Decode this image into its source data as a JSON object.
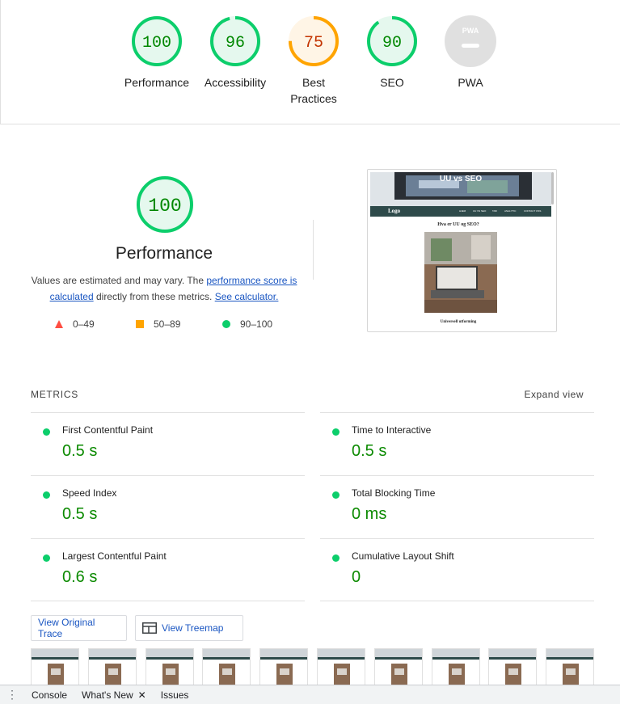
{
  "gauges": [
    {
      "score": "100",
      "label": "Performance",
      "fraction": 1.0,
      "color": "#0cce6b",
      "text_color": "#008800",
      "fill": "#e5f8ee"
    },
    {
      "score": "96",
      "label": "Accessibility",
      "fraction": 0.96,
      "color": "#0cce6b",
      "text_color": "#008800",
      "fill": "#e5f8ee"
    },
    {
      "score": "75",
      "label": "Best Practices",
      "fraction": 0.75,
      "color": "#ffa400",
      "text_color": "#c33300",
      "fill": "#fff5e6"
    },
    {
      "score": "90",
      "label": "SEO",
      "fraction": 0.9,
      "color": "#0cce6b",
      "text_color": "#008800",
      "fill": "#e5f8ee"
    },
    {
      "score": "",
      "label": "PWA",
      "badge": "PWA",
      "color": "#e0e0e0"
    }
  ],
  "performance": {
    "score": "100",
    "title": "Performance",
    "desc_start": "Values are estimated and may vary. The ",
    "desc_link1": "performance score is calculated",
    "desc_mid": " directly from these metrics. ",
    "desc_link2": "See calculator.",
    "legend": [
      {
        "range": "0–49",
        "shape": "triangle",
        "color": "#ff4e42"
      },
      {
        "range": "50–89",
        "shape": "square",
        "color": "#ffa400"
      },
      {
        "range": "90–100",
        "shape": "circle",
        "color": "#0cce6b"
      }
    ]
  },
  "screenshot": {
    "hero_title": "UU vs SEO",
    "logo": "Logo",
    "nav": [
      "HJEM",
      "UU VS SEO",
      "TAB",
      "ANALYTIC",
      "CONTACT OSS"
    ],
    "heading": "Hva er UU og SEO?",
    "footer": "Universell utforming"
  },
  "metrics": {
    "header": "METRICS",
    "expand": "Expand view",
    "items": [
      {
        "name": "First Contentful Paint",
        "value": "0.5 s"
      },
      {
        "name": "Time to Interactive",
        "value": "0.5 s"
      },
      {
        "name": "Speed Index",
        "value": "0.5 s"
      },
      {
        "name": "Total Blocking Time",
        "value": "0 ms"
      },
      {
        "name": "Largest Contentful Paint",
        "value": "0.6 s"
      },
      {
        "name": "Cumulative Layout Shift",
        "value": "0"
      }
    ]
  },
  "buttons": {
    "trace": "View Original Trace",
    "treemap": "View Treemap"
  },
  "filmstrip_count": 10,
  "bottombar": {
    "tabs": [
      "Console",
      "What's New",
      "Issues"
    ]
  }
}
